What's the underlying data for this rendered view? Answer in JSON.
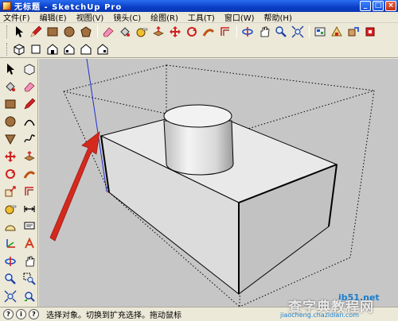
{
  "window": {
    "title": "无标题 - SketchUp Pro",
    "minimize_label": "_",
    "maximize_label": "□",
    "close_label": "×"
  },
  "menu": {
    "items": [
      "文件(F)",
      "编辑(E)",
      "视图(V)",
      "镜头(C)",
      "绘图(R)",
      "工具(T)",
      "窗口(W)",
      "帮助(H)"
    ]
  },
  "toolbar_row1": {
    "icons": [
      "select-arrow-icon",
      "pencil-icon",
      "rectangle-icon",
      "circle-icon",
      "polygon-icon",
      "eraser-icon",
      "paint-bucket-icon",
      "tape-measure-icon",
      "push-pull-icon",
      "move-icon",
      "rotate-icon",
      "follow-me-icon",
      "offset-icon",
      "orbit-icon",
      "pan-icon",
      "zoom-icon",
      "zoom-extents-icon",
      "warehouse-icon",
      "components-icon",
      "share-model-icon",
      "extension-icon"
    ]
  },
  "toolbar_row2": {
    "icons": [
      "iso-view-icon",
      "top-view-icon",
      "front-view-icon",
      "right-view-icon",
      "back-view-icon",
      "left-view-icon"
    ]
  },
  "left_toolbar": {
    "icons": [
      "select-icon",
      "make-component-icon",
      "paint-bucket-icon",
      "eraser-icon",
      "rectangle-icon",
      "line-icon",
      "circle-icon",
      "arc-icon",
      "polygon-icon",
      "freehand-icon",
      "move-icon",
      "push-pull-icon",
      "rotate-icon",
      "follow-me-icon",
      "scale-icon",
      "offset-icon",
      "tape-measure-icon",
      "dimension-icon",
      "protractor-icon",
      "text-icon",
      "axes-icon",
      "3d-text-icon",
      "orbit-icon",
      "pan-icon",
      "zoom-icon",
      "zoom-window-icon",
      "zoom-extents-icon",
      "previous-view-icon",
      "position-camera-icon",
      "walk-icon"
    ]
  },
  "status": {
    "text": "选择对象。切换到扩充选择。拖动鼠标",
    "icon_labels": [
      "?",
      "i",
      "?"
    ]
  },
  "watermark": {
    "logo": "jb51.net",
    "main": "查字典教程网",
    "sub": "jiaocheng.chazidian.com"
  },
  "colors": {
    "titlebar": "#0a3fc8",
    "background": "#c6c6c6",
    "chrome": "#ece9d8",
    "arrow": "#d42a1e",
    "axis_blue": "#2030d0",
    "axis_red": "#c02020"
  }
}
